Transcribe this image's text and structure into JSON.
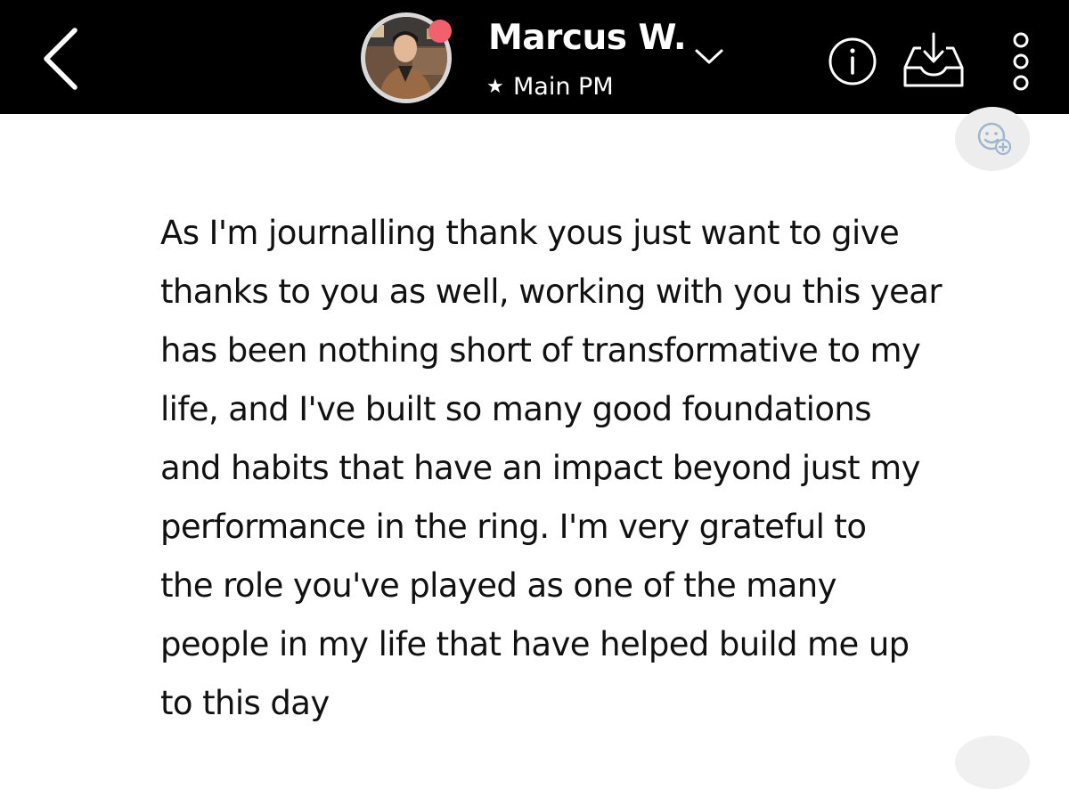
{
  "header": {
    "contact_name": "Marcus W.",
    "subtitle": "Main PM",
    "star_icon": "star-icon",
    "status_dot_color": "#f0616d",
    "icons": {
      "back": "chevron-left-icon",
      "expand": "chevron-down-icon",
      "info": "info-icon",
      "inbox": "inbox-download-icon",
      "more": "more-vertical-icon"
    }
  },
  "reaction": {
    "icon": "add-reaction-icon"
  },
  "message": {
    "text": "As I'm journalling thank yous just want to give\nthanks to you as well, working with you this year\nhas been nothing short of transformative to my\nlife, and I've built so many good foundations\nand habits that have an impact beyond just my\nperformance in the ring. I'm very grateful to\nthe role you've played as one of the many\npeople in my life that have helped build me up\nto this day"
  }
}
